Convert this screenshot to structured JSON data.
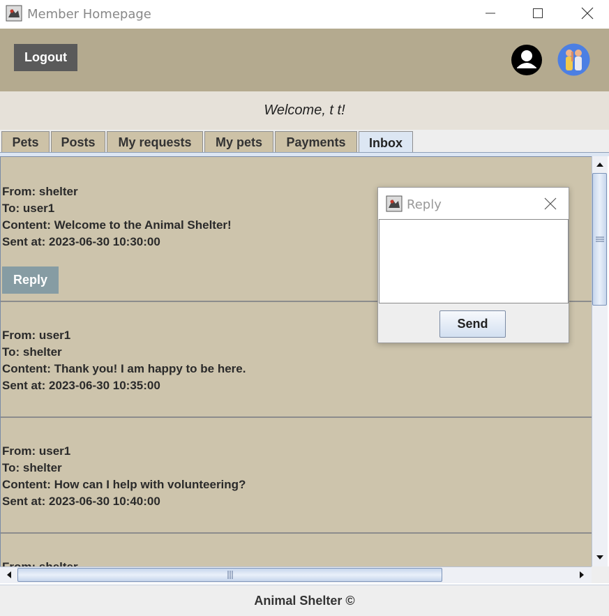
{
  "window": {
    "title": "Member Homepage",
    "icon": "java-app-icon"
  },
  "header": {
    "logout_label": "Logout",
    "profile_icon": "user-profile-icon",
    "avatar": "avatar"
  },
  "welcome": {
    "text": "Welcome, t t!"
  },
  "tabs": [
    {
      "label": "Pets"
    },
    {
      "label": "Posts"
    },
    {
      "label": "My requests"
    },
    {
      "label": "My pets"
    },
    {
      "label": "Payments"
    },
    {
      "label": "Inbox",
      "active": true
    }
  ],
  "messages": [
    {
      "from": "From: shelter",
      "to": "To: user1",
      "content": "Content: Welcome to the Animal Shelter!",
      "sent": "Sent at: 2023-06-30 10:30:00",
      "reply_label": "Reply"
    },
    {
      "from": "From: user1",
      "to": "To: shelter",
      "content": "Content: Thank you! I am happy to be here.",
      "sent": "Sent at: 2023-06-30 10:35:00"
    },
    {
      "from": "From: user1",
      "to": "To: shelter",
      "content": "Content: How can I help with volunteering?",
      "sent": "Sent at: 2023-06-30 10:40:00"
    },
    {
      "from": "From: shelter"
    }
  ],
  "dialog": {
    "title": "Reply",
    "text_value": "",
    "send_label": "Send"
  },
  "footer": {
    "text": "Animal Shelter ©"
  },
  "colors": {
    "header_bg": "#b4aa8f",
    "content_bg": "#cdc4ac",
    "reply_button": "#869ca3",
    "logout_button": "#5a5a5a",
    "active_tab": "#dce6f3"
  }
}
